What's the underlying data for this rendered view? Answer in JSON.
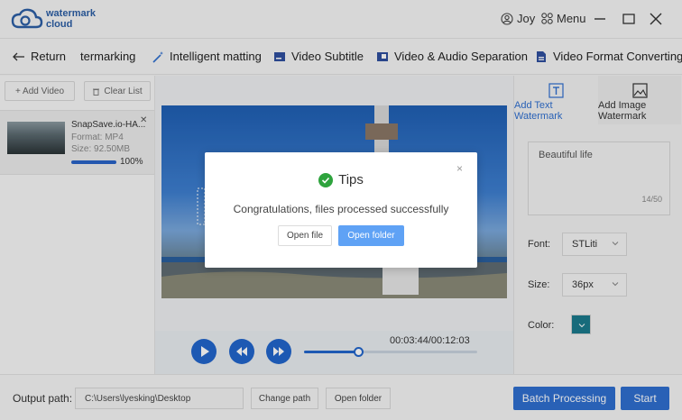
{
  "app": {
    "logo_line1": "watermark",
    "logo_line2": "cloud",
    "user_name": "Joy",
    "menu_label": "Menu"
  },
  "toolbar": {
    "return_label": "Return",
    "items": [
      "termarking",
      "Intelligent matting",
      "Video Subtitle",
      "Video & Audio Separation",
      "Video Format Converting"
    ]
  },
  "file_panel": {
    "add_video_label": "+ Add Video",
    "clear_list_label": "Clear List",
    "file": {
      "name": "SnapSave.io-HA...",
      "format": "Format:  MP4",
      "size": "Size:  92.50MB",
      "progress_text": "100%",
      "progress": 1.0
    }
  },
  "player": {
    "time": "00:03:44/00:12:03",
    "seek_fraction": 0.31
  },
  "watermark_panel": {
    "tabs": [
      {
        "line1": "Add Text",
        "line2": "Watermark",
        "active": true
      },
      {
        "line1": "Add Image",
        "line2": "Watermark",
        "active": false
      }
    ],
    "text_value": "Beautiful life",
    "char_count": "14/50",
    "font_label": "Font:",
    "font_value": "STLiti",
    "size_label": "Size:",
    "size_value": "36px",
    "color_label": "Color:",
    "color_value": "#1b7a8c"
  },
  "bottom": {
    "output_label": "Output path:",
    "output_path": "C:\\Users\\lyesking\\Desktop",
    "change_path_label": "Change path",
    "open_folder_label": "Open folder",
    "batch_label": "Batch Processing",
    "start_label": "Start"
  },
  "dialog": {
    "title": "Tips",
    "message": "Congratulations, files processed successfully",
    "open_file_label": "Open file",
    "open_folder_label": "Open folder",
    "close_symbol": "×"
  },
  "colors": {
    "accent": "#2f6fd0",
    "success": "#2ea33d",
    "dialog_primary": "#5fa2f5"
  }
}
